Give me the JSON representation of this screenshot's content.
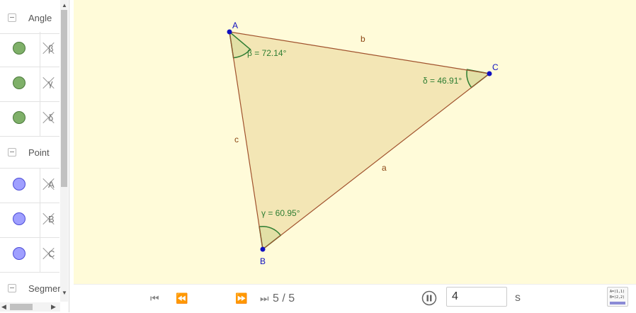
{
  "algebra": {
    "groups": [
      {
        "name": "Angle",
        "items": [
          {
            "label": "β",
            "color": "#7fb069"
          },
          {
            "label": "γ",
            "color": "#7fb069"
          },
          {
            "label": "δ",
            "color": "#7fb069"
          }
        ]
      },
      {
        "name": "Point",
        "items": [
          {
            "label": "A",
            "color": "#9f9fff"
          },
          {
            "label": "B",
            "color": "#9f9fff"
          },
          {
            "label": "C",
            "color": "#9f9fff"
          }
        ]
      },
      {
        "name": "Segmer",
        "items": []
      }
    ]
  },
  "graphics": {
    "points": {
      "A": "A",
      "B": "B",
      "C": "C"
    },
    "segments": {
      "a": "a",
      "b": "b",
      "c": "c"
    },
    "angles": {
      "beta": "β = 72.14°",
      "gamma": "γ = 60.95°",
      "delta": "δ = 46.91°"
    },
    "colors": {
      "background": "#fffbd9",
      "triangle_fill": "#f3e6b5",
      "edge": "#a0522d",
      "angle": "#2e7d32",
      "point": "#1010c0"
    }
  },
  "toolbar": {
    "counter": "5 / 5",
    "speed_value": "4",
    "unit": "s",
    "icons": [
      "skip-first-icon",
      "step-back-icon",
      "step-forward-icon",
      "skip-last-icon",
      "pause-icon",
      "algebra-view-icon"
    ],
    "algebra_icon_lines": [
      "A=(1,1)",
      "B=(2,2)"
    ]
  }
}
